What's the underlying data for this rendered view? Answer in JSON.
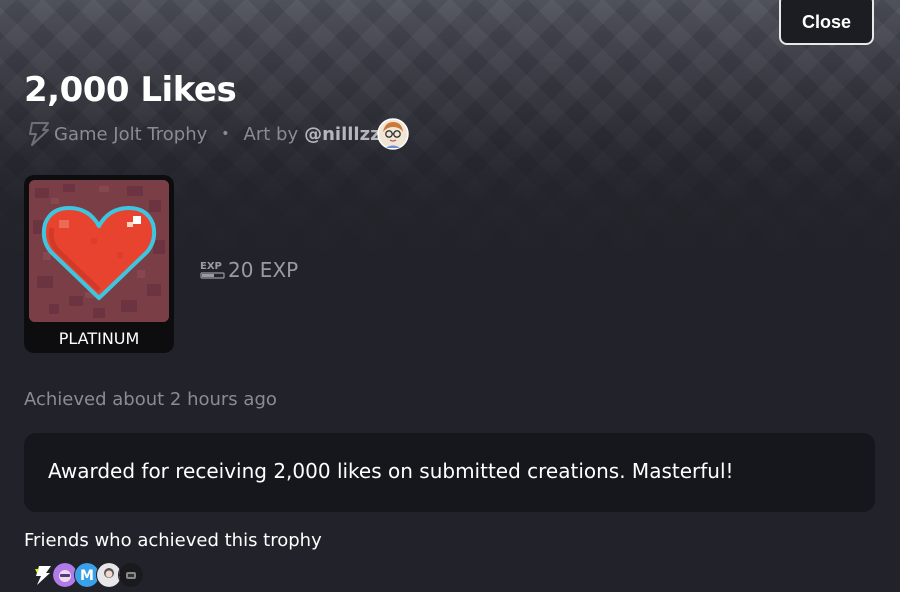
{
  "close_label": "Close",
  "trophy": {
    "title": "2,000 Likes",
    "source": "Game Jolt Trophy",
    "separator": "•",
    "art_by_prefix": "Art by",
    "artist": "@nilllzz",
    "tier": "PLATINUM",
    "exp": "20 EXP",
    "achieved": "Achieved about 2 hours ago",
    "description": "Awarded for receiving 2,000 likes on submitted creations. Masterful!"
  },
  "friends": {
    "label": "Friends who achieved this trophy",
    "avatars": [
      "friend-avatar-bolt",
      "friend-avatar-purple",
      "friend-avatar-m",
      "friend-avatar-white",
      "friend-avatar-dark"
    ]
  },
  "colors": {
    "background": "#22232a",
    "card": "#16171c",
    "muted_text": "#8b8c93",
    "heart": "#e8432f",
    "heart_outline": "#3ec6e0",
    "trophy_bg": "#7a3e47"
  }
}
